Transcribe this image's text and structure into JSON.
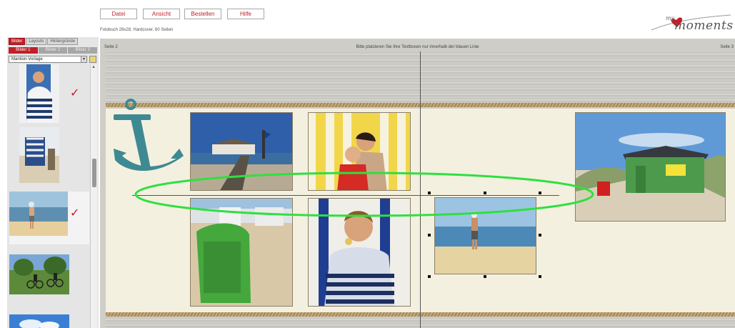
{
  "menu": {
    "file": "Datei",
    "view": "Ansicht",
    "order": "Bestellen",
    "help": "Hilfe"
  },
  "product_info": "Fotobuch 28x28, Hardcover, 60 Seiten",
  "logo": {
    "my": "my",
    "moments": "moments"
  },
  "sidebar": {
    "tabs": [
      "Bilder",
      "Layouts",
      "Hintergründe"
    ],
    "subtabs": [
      "Bilder 1",
      "Bilder 2",
      "Bilder 3"
    ],
    "album_select": "Mantion-Vorlage"
  },
  "editor": {
    "page_left": "Seite 2",
    "page_right": "Seite 3",
    "instruction": "Bitte platzieren Sie Ihre Textboxen nur innerhalb der blauen Linie"
  },
  "colors": {
    "accent": "#c0202a",
    "highlight": "#2ee040",
    "anchor": "#3e8a92"
  },
  "icons": [
    "anchor-icon",
    "checkmark-icon",
    "folder-icon",
    "dropdown-arrow-icon"
  ]
}
